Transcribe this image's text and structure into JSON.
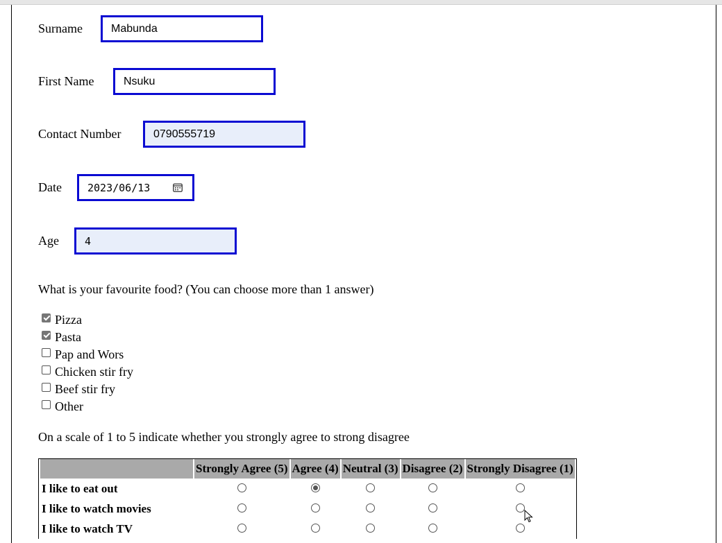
{
  "form": {
    "surname": {
      "label": "Surname",
      "value": "Mabunda"
    },
    "first_name": {
      "label": "First Name",
      "value": "Nsuku"
    },
    "contact": {
      "label": "Contact Number",
      "value": "0790555719"
    },
    "date": {
      "label": "Date",
      "value": "2023/06/13"
    },
    "age": {
      "label": "Age",
      "value": "4"
    }
  },
  "food": {
    "question": "What is your favourite food? (You can choose more than 1 answer)",
    "options": [
      {
        "label": "Pizza",
        "checked": true
      },
      {
        "label": "Pasta",
        "checked": true
      },
      {
        "label": "Pap and Wors",
        "checked": false
      },
      {
        "label": "Chicken stir fry",
        "checked": false
      },
      {
        "label": "Beef stir fry",
        "checked": false
      },
      {
        "label": "Other",
        "checked": false
      }
    ]
  },
  "scale": {
    "instruction": "On a scale of 1 to 5 indicate whether you strongly agree to strong disagree",
    "columns": [
      "Strongly Agree (5)",
      "Agree (4)",
      "Neutral (3)",
      "Disagree (2)",
      "Strongly Disagree (1)"
    ],
    "rows": [
      {
        "label": "I like to eat out",
        "selected": "Agree (4)"
      },
      {
        "label": "I like to watch movies",
        "selected": null
      },
      {
        "label": "I like to watch TV",
        "selected": null
      }
    ]
  },
  "icons": {
    "date_picker": "calendar-icon",
    "pointer": "mouse-cursor-icon",
    "checked_color": "#767676",
    "field_border_color": "#0a0ad2"
  }
}
